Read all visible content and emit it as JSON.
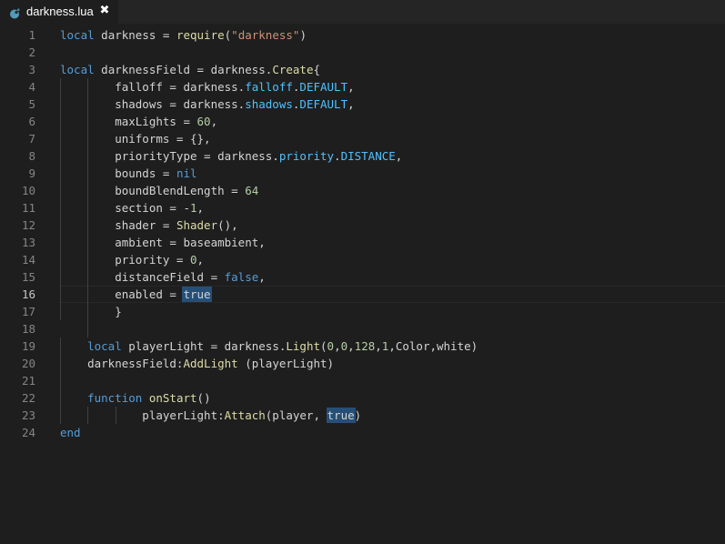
{
  "tab": {
    "title": "darkness.lua",
    "icon": "lua-file-icon",
    "close_glyph": "✖"
  },
  "editor": {
    "active_line": 16,
    "line_numbers": [
      "1",
      "2",
      "3",
      "4",
      "5",
      "6",
      "7",
      "8",
      "9",
      "10",
      "11",
      "12",
      "13",
      "14",
      "15",
      "16",
      "17",
      "18",
      "19",
      "20",
      "21",
      "22",
      "23",
      "24"
    ],
    "colors": {
      "background": "#1e1e1e",
      "keyword": "#569cd6",
      "string": "#ce9178",
      "number": "#b5cea8",
      "function": "#dcdcaa",
      "field": "#4fc1ff",
      "text": "#d4d4d4"
    },
    "lines": [
      [
        [
          "kw",
          "local"
        ],
        [
          "plain",
          " darkness = "
        ],
        [
          "fn",
          "require"
        ],
        [
          "plain",
          "("
        ],
        [
          "str",
          "\"darkness\""
        ],
        [
          "plain",
          ")"
        ]
      ],
      [],
      [
        [
          "kw",
          "local"
        ],
        [
          "plain",
          " darknessField = darkness."
        ],
        [
          "fn",
          "Create"
        ],
        [
          "plain",
          "{"
        ]
      ],
      [
        [
          "plain",
          "        falloff = darkness."
        ],
        [
          "fld",
          "falloff"
        ],
        [
          "plain",
          "."
        ],
        [
          "fld",
          "DEFAULT"
        ],
        [
          "plain",
          ","
        ]
      ],
      [
        [
          "plain",
          "        shadows = darkness."
        ],
        [
          "fld",
          "shadows"
        ],
        [
          "plain",
          "."
        ],
        [
          "fld",
          "DEFAULT"
        ],
        [
          "plain",
          ","
        ]
      ],
      [
        [
          "plain",
          "        maxLights = "
        ],
        [
          "num",
          "60"
        ],
        [
          "plain",
          ","
        ]
      ],
      [
        [
          "plain",
          "        uniforms = {},"
        ]
      ],
      [
        [
          "plain",
          "        priorityType = darkness."
        ],
        [
          "fld",
          "priority"
        ],
        [
          "plain",
          "."
        ],
        [
          "fld",
          "DISTANCE"
        ],
        [
          "plain",
          ","
        ]
      ],
      [
        [
          "plain",
          "        bounds = "
        ],
        [
          "kw",
          "nil"
        ]
      ],
      [
        [
          "plain",
          "        boundBlendLength = "
        ],
        [
          "num",
          "64"
        ]
      ],
      [
        [
          "plain",
          "        section = -"
        ],
        [
          "num",
          "1"
        ],
        [
          "plain",
          ","
        ]
      ],
      [
        [
          "plain",
          "        shader = "
        ],
        [
          "fn",
          "Shader"
        ],
        [
          "plain",
          "(),"
        ]
      ],
      [
        [
          "plain",
          "        ambient = baseambient,"
        ]
      ],
      [
        [
          "plain",
          "        priority = "
        ],
        [
          "num",
          "0"
        ],
        [
          "plain",
          ","
        ]
      ],
      [
        [
          "plain",
          "        distanceField = "
        ],
        [
          "kw",
          "false"
        ],
        [
          "plain",
          ","
        ]
      ],
      [
        [
          "plain",
          "        enabled = "
        ],
        [
          "hl",
          "true"
        ]
      ],
      [
        [
          "plain",
          "        }"
        ]
      ],
      [],
      [
        [
          "plain",
          "    "
        ],
        [
          "kw",
          "local"
        ],
        [
          "plain",
          " playerLight = darkness."
        ],
        [
          "fn",
          "Light"
        ],
        [
          "plain",
          "("
        ],
        [
          "num",
          "0"
        ],
        [
          "plain",
          ","
        ],
        [
          "num",
          "0"
        ],
        [
          "plain",
          ","
        ],
        [
          "num",
          "128"
        ],
        [
          "plain",
          ","
        ],
        [
          "num",
          "1"
        ],
        [
          "plain",
          ",Color,white)"
        ]
      ],
      [
        [
          "plain",
          "    darknessField:"
        ],
        [
          "fn",
          "AddLight"
        ],
        [
          "plain",
          " (playerLight)"
        ]
      ],
      [],
      [
        [
          "plain",
          "    "
        ],
        [
          "kw",
          "function"
        ],
        [
          "plain",
          " "
        ],
        [
          "fn",
          "onStart"
        ],
        [
          "plain",
          "()"
        ]
      ],
      [
        [
          "plain",
          "            playerLight:"
        ],
        [
          "fn",
          "Attach"
        ],
        [
          "plain",
          "(player, "
        ],
        [
          "hl",
          "true"
        ],
        [
          "plain",
          ")"
        ]
      ],
      [
        [
          "kw",
          "end"
        ]
      ]
    ]
  }
}
